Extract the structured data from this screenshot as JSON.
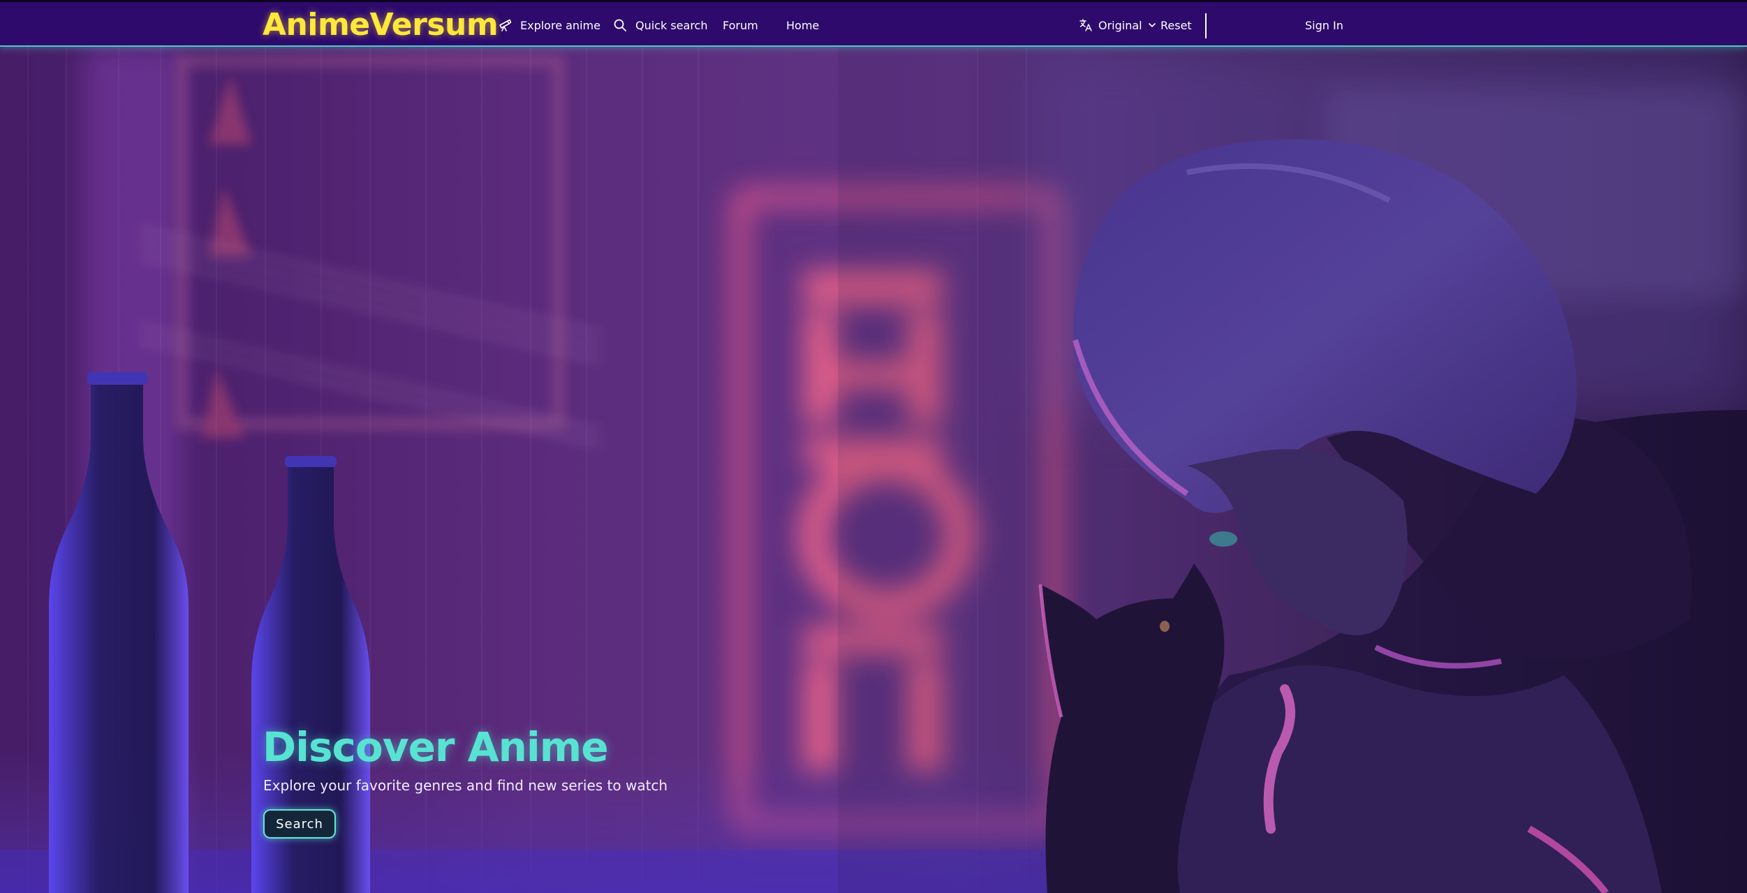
{
  "header": {
    "logo": "AnimeVersum",
    "nav": {
      "explore": "Explore anime",
      "quick_search": "Quick search",
      "forum": "Forum",
      "home": "Home"
    },
    "language_select": "Original",
    "reset": "Reset",
    "sign_in": "Sign In"
  },
  "hero": {
    "title": "Discover Anime",
    "subtitle": "Explore your favorite genres and find new series to watch",
    "button": "Search"
  },
  "icons": {
    "explore": "telescope-icon",
    "quick_search": "search-icon",
    "language": "translate-icon",
    "dropdown": "chevron-down-icon"
  },
  "colors": {
    "header_bg": "#2d0a6c",
    "header_border": "#4ec9c2",
    "logo": "#ffe838",
    "hero_title": "#57e3d2",
    "button_border": "#5ee8d7"
  }
}
